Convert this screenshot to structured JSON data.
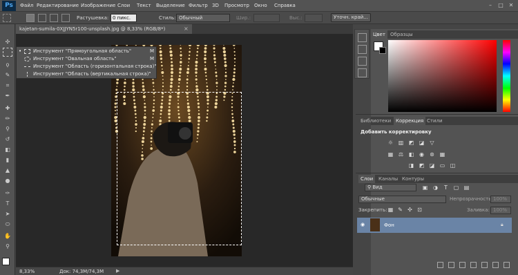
{
  "app": {
    "logo": "Ps"
  },
  "menu": [
    "Файл",
    "Редактирование",
    "Изображение",
    "Слои",
    "Текст",
    "Выделение",
    "Фильтр",
    "3D",
    "Просмотр",
    "Окно",
    "Справка"
  ],
  "window_controls": [
    "–",
    "□",
    "✕"
  ],
  "options": {
    "feather_label": "Растушевка:",
    "feather_value": "0 пикс.",
    "style_label": "Стиль:",
    "style_value": "Обычный",
    "width_label": "Шир.:",
    "height_label": "Выс.:",
    "refine_button": "Уточн. край..."
  },
  "document": {
    "tab_title": "kajetan-sumila-0XJJYN5r100-unsplash.jpg @ 8,33% (RGB/8*)",
    "close": "×"
  },
  "tool_flyout": [
    {
      "label": "Инструмент \"Прямоугольная область\"",
      "key": "M",
      "icon": "rect-marquee-icon",
      "selected": true
    },
    {
      "label": "Инструмент \"Овальная область\"",
      "key": "M",
      "icon": "ellipse-marquee-icon",
      "selected": false
    },
    {
      "label": "Инструмент \"Область (горизонтальная строка)\"",
      "key": "",
      "icon": "row-marquee-icon",
      "selected": false
    },
    {
      "label": "Инструмент \"Область (вертикальная строка)\"",
      "key": "",
      "icon": "column-marquee-icon",
      "selected": false
    }
  ],
  "status": {
    "zoom": "8,33%",
    "doc_size": "Док: 74,3M/74,3M"
  },
  "color_panel": {
    "tabs": [
      "Цвет",
      "Образцы"
    ],
    "foreground": "#ffffff",
    "background": "#000000"
  },
  "adjustments_panel": {
    "tabs": [
      "Библиотеки",
      "Коррекция",
      "Стили"
    ],
    "title": "Добавить корректировку"
  },
  "layers_panel": {
    "tabs": [
      "Слои",
      "Каналы",
      "Контуры"
    ],
    "filter_label": "Вид",
    "blend_mode": "Обычные",
    "opacity_label": "Непрозрачность:",
    "opacity_value": "100%",
    "lock_label": "Закрепить:",
    "fill_label": "Заливка:",
    "fill_value": "100%",
    "layers": [
      {
        "name": "Фон",
        "visible": true,
        "locked": true
      }
    ]
  },
  "colors": {
    "accent_selected_layer": "#6a84a6",
    "ps_logo_bg": "#0b2a45",
    "ps_logo_fg": "#4ea7f2"
  }
}
